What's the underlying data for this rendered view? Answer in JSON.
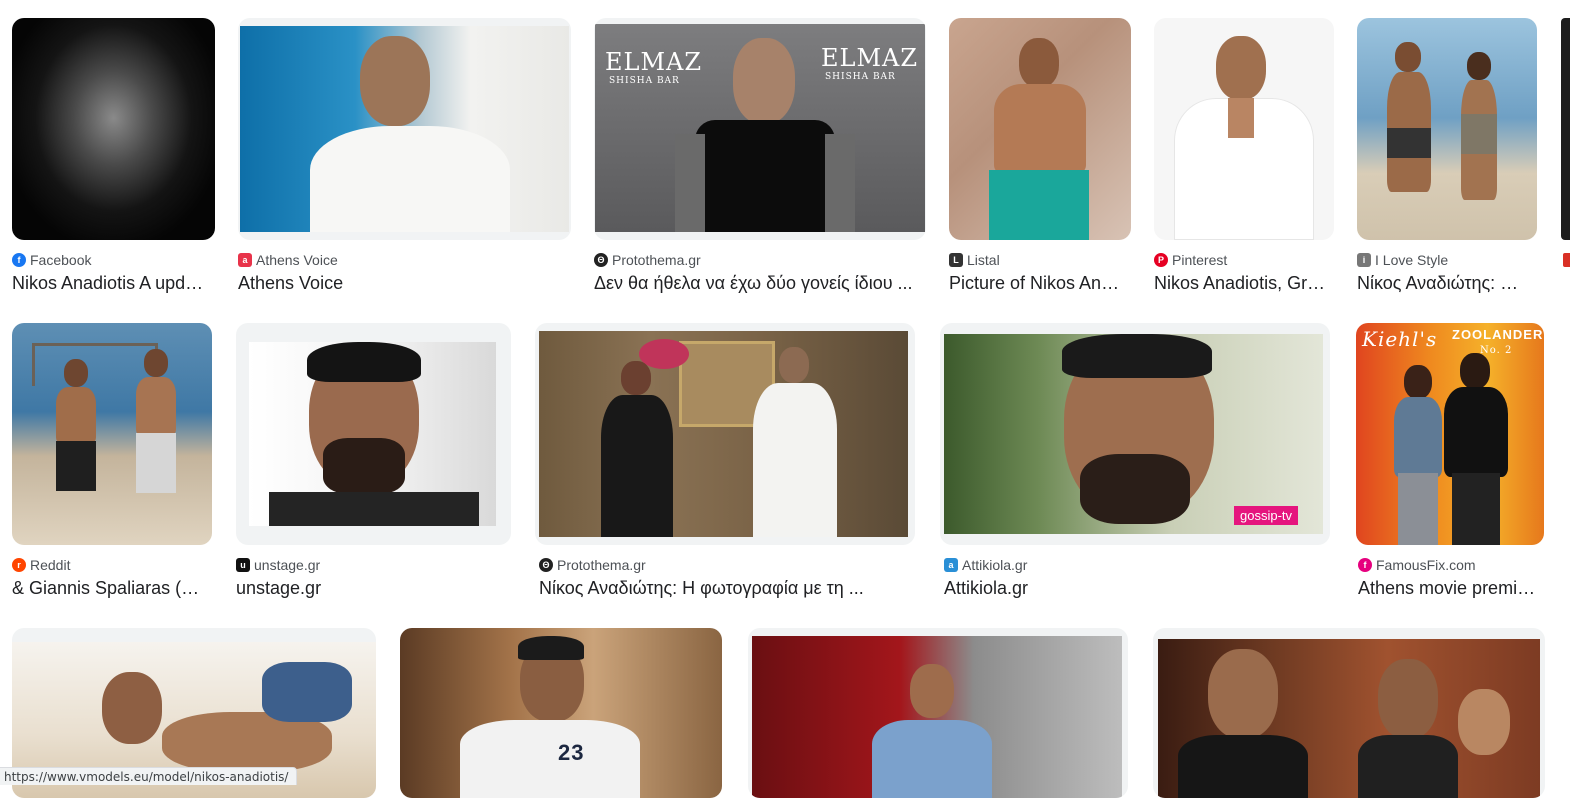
{
  "results": [
    {
      "source": "Facebook",
      "title": "Nikos Anadiotis A upd…",
      "favicon": "facebook-icon",
      "favicon_color": "#1877f2"
    },
    {
      "source": "Athens Voice",
      "title": "Athens Voice",
      "favicon": "athens-voice-icon",
      "favicon_color": "#e8334a"
    },
    {
      "source": "Protothema.gr",
      "title": "Δεν θα ήθελα να έχω δύο γονείς ίδιου ...",
      "favicon": "protothema-icon",
      "favicon_color": "#222222"
    },
    {
      "source": "Listal",
      "title": "Picture of Nikos An…",
      "favicon": "listal-icon",
      "favicon_color": "#333333"
    },
    {
      "source": "Pinterest",
      "title": "Nikos Anadiotis, Gr…",
      "favicon": "pinterest-icon",
      "favicon_color": "#e60023"
    },
    {
      "source": "I Love Style",
      "title": "Νίκος Αναδιώτης: …",
      "favicon": "ilovestyle-icon",
      "favicon_color": "#777777"
    },
    {
      "source": "Reddit",
      "title": "& Giannis Spaliaras (…",
      "favicon": "reddit-icon",
      "favicon_color": "#ff4500"
    },
    {
      "source": "unstage.gr",
      "title": "unstage.gr",
      "favicon": "unstage-icon",
      "favicon_color": "#111111"
    },
    {
      "source": "Protothema.gr",
      "title": "Νίκος Αναδιώτης: Η φωτογραφία με τη ...",
      "favicon": "protothema-icon",
      "favicon_color": "#222222"
    },
    {
      "source": "Attikiola.gr",
      "title": "Attikiola.gr",
      "favicon": "attikiola-icon",
      "favicon_color": "#2a8fd6"
    },
    {
      "source": "FamousFix.com",
      "title": "Athens movie premi…",
      "favicon": "famousfix-icon",
      "favicon_color": "#e6007e"
    }
  ],
  "picture_text": {
    "elmaz_left": "ELMAZ",
    "elmaz_left_sub": "SHISHA BAR",
    "elmaz_right": "ELMAZ",
    "elmaz_right_sub": "SHISHA BAR",
    "gossip_badge": "gossip-tv",
    "kiehls": "Kiehl's",
    "zoolander": "ZOOLANDER",
    "zoolander_sub": "No. 2",
    "jersey_number": "23"
  },
  "status_bar": {
    "url": "https://www.vmodels.eu/model/nikos-anadiotis/"
  }
}
